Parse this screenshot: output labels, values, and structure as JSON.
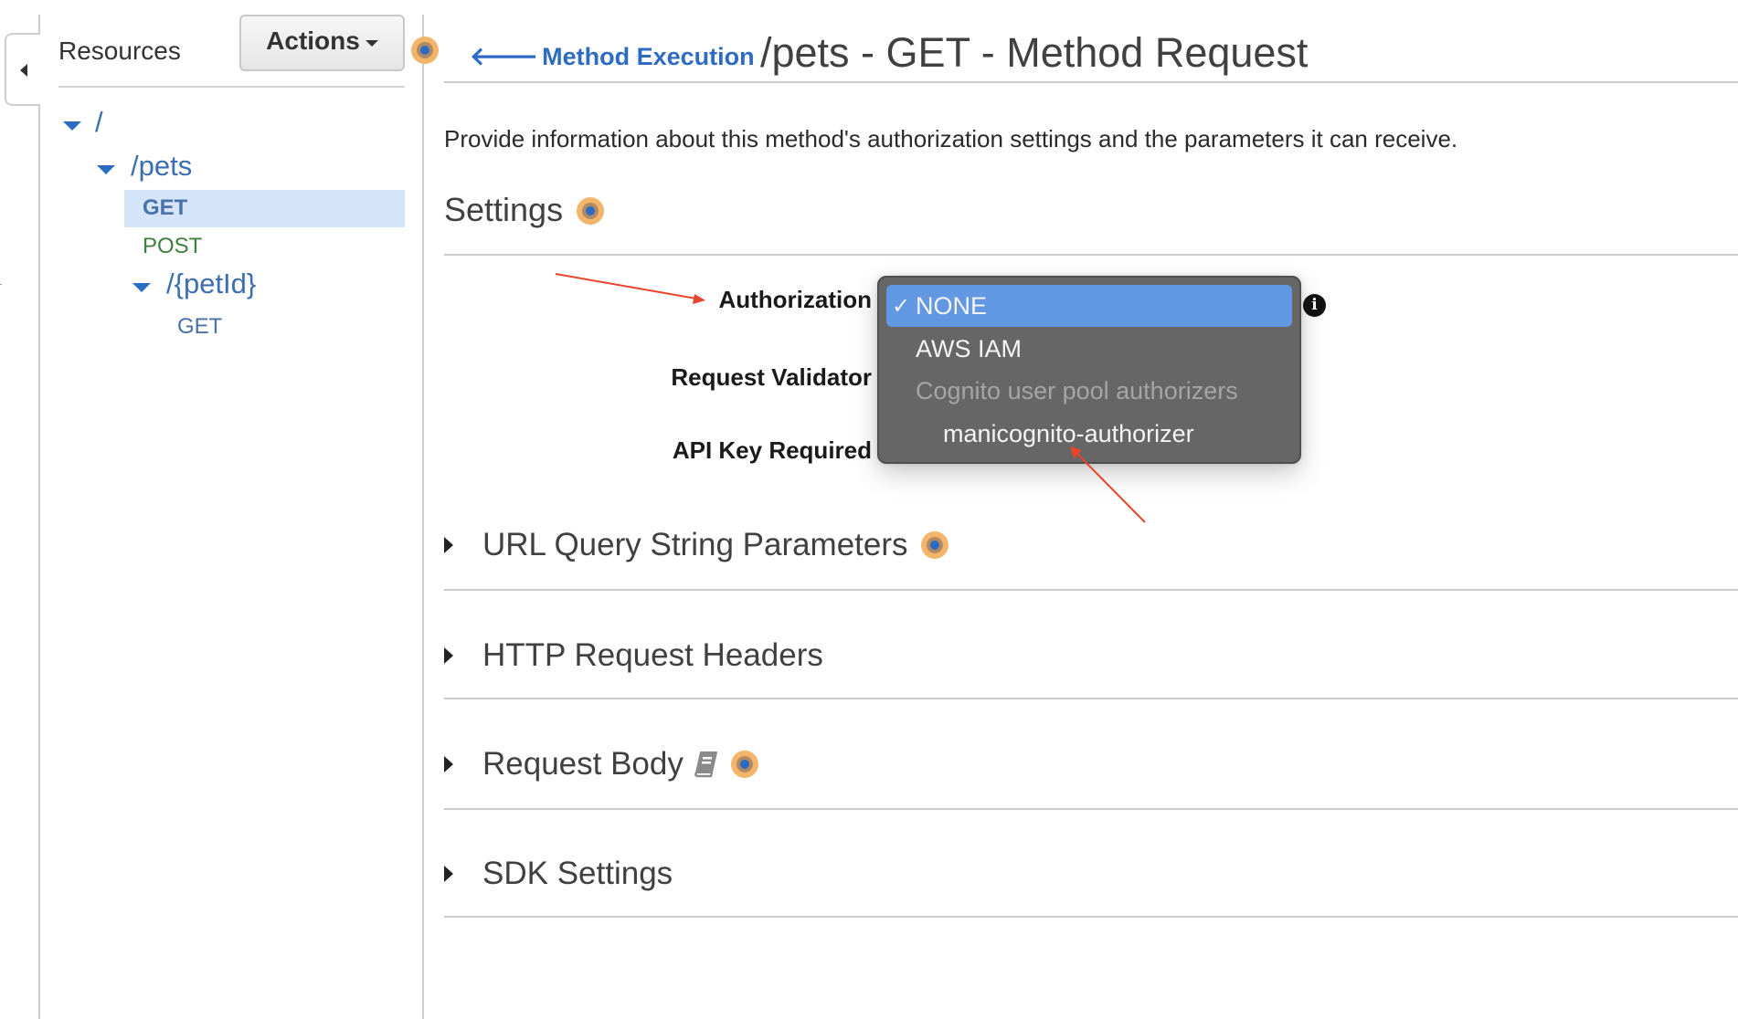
{
  "sidebar": {
    "title": "Resources",
    "actions_label": "Actions",
    "tree": [
      {
        "label": "/",
        "type": "resource",
        "expanded": true
      },
      {
        "label": "/pets",
        "type": "resource",
        "expanded": true
      },
      {
        "label": "GET",
        "type": "method",
        "selected": true
      },
      {
        "label": "POST",
        "type": "method"
      },
      {
        "label": "/{petId}",
        "type": "resource",
        "expanded": true
      },
      {
        "label": "GET",
        "type": "method"
      }
    ]
  },
  "header": {
    "back_link": "Method Execution",
    "title": "/pets - GET - Method Request"
  },
  "main": {
    "description": "Provide information about this method's authorization settings and the parameters it can receive.",
    "settings_heading": "Settings",
    "fields": {
      "authorization": "Authorization",
      "request_validator": "Request Validator",
      "api_key_required": "API Key Required"
    },
    "authorization_dropdown": {
      "selected": "NONE",
      "check": "✓",
      "options": [
        {
          "label": "NONE",
          "selected": true
        },
        {
          "label": "AWS IAM"
        },
        {
          "label": "Cognito user pool authorizers",
          "group_header": true
        },
        {
          "label": "manicognito-authorizer",
          "indented": true
        }
      ]
    },
    "sections": [
      {
        "label": "URL Query String Parameters",
        "help": true
      },
      {
        "label": "HTTP Request Headers",
        "help": false
      },
      {
        "label": "Request Body",
        "help": true,
        "book_icon": true
      },
      {
        "label": "SDK Settings",
        "help": false
      }
    ]
  },
  "icons": {
    "back_arrow": "arrow-left-icon",
    "info": "info-icon",
    "help": "help-dot-icon",
    "book": "book-icon",
    "disclosure": "caret-right-icon"
  },
  "colors": {
    "link_blue": "#2e6bc2",
    "post_green": "#3d7f3d",
    "selected_bg": "#d4e5fa",
    "dropdown_bg": "#666666",
    "dropdown_selected": "#6298e2",
    "annotation_red": "#e8452c",
    "help_orange": "#f3b56a"
  }
}
